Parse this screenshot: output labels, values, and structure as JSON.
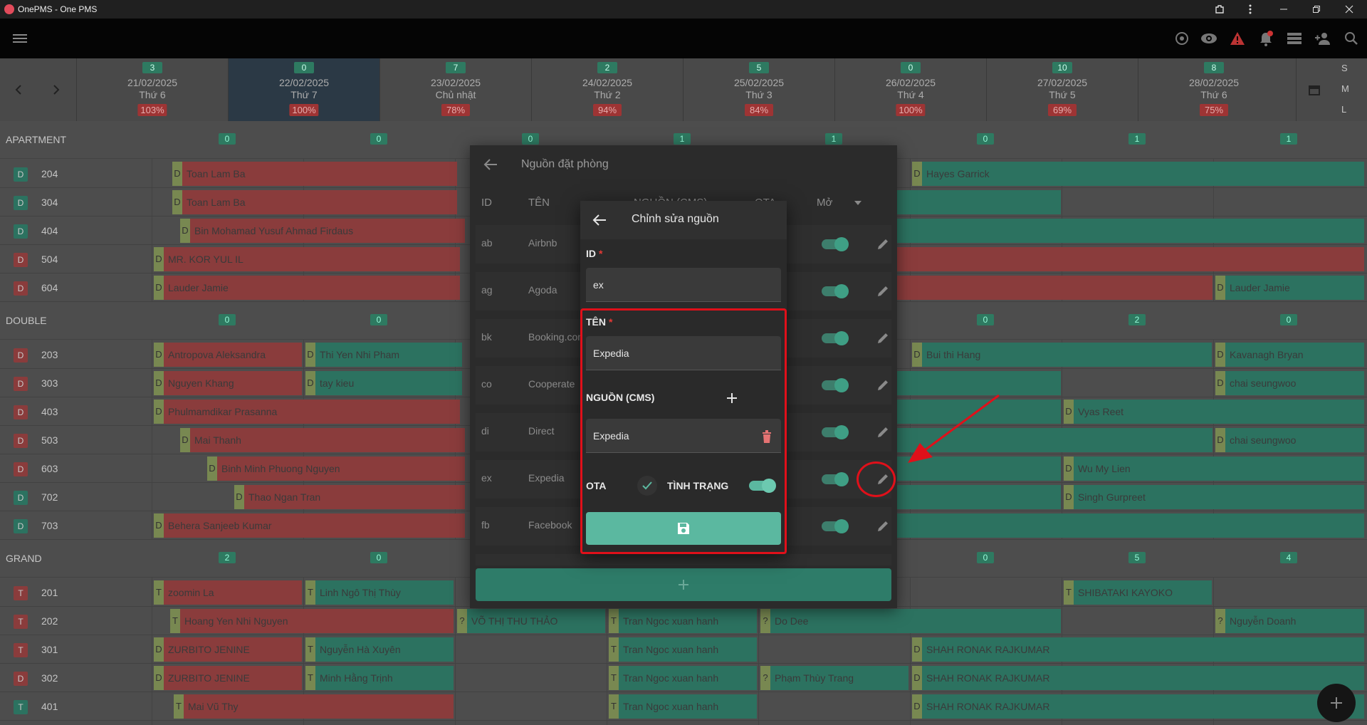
{
  "window": {
    "title": "OnePMS - One PMS"
  },
  "appbar": {
    "icons": [
      "menu-icon",
      "globe-icon",
      "eye-icon",
      "warning-icon",
      "bell-icon",
      "list-icon",
      "add-user-icon",
      "search-icon"
    ]
  },
  "dates": [
    {
      "count": "3",
      "date": "21/02/2025",
      "weekday": "Thứ 6",
      "occ": "103%"
    },
    {
      "count": "0",
      "date": "22/02/2025",
      "weekday": "Thứ 7",
      "occ": "100%"
    },
    {
      "count": "7",
      "date": "23/02/2025",
      "weekday": "Chủ nhật",
      "occ": "78%"
    },
    {
      "count": "2",
      "date": "24/02/2025",
      "weekday": "Thứ 2",
      "occ": "94%"
    },
    {
      "count": "5",
      "date": "25/02/2025",
      "weekday": "Thứ 3",
      "occ": "84%"
    },
    {
      "count": "0",
      "date": "26/02/2025",
      "weekday": "Thứ 4",
      "occ": "100%"
    },
    {
      "count": "10",
      "date": "27/02/2025",
      "weekday": "Thứ 5",
      "occ": "69%"
    },
    {
      "count": "8",
      "date": "28/02/2025",
      "weekday": "Thứ 6",
      "occ": "75%"
    }
  ],
  "size_toggle": [
    "S",
    "M",
    "L"
  ],
  "groups": {
    "apartment": {
      "name": "APARTMENT",
      "counts": [
        "0",
        "0",
        "0",
        "1",
        "1",
        "0",
        "1",
        "1"
      ]
    },
    "double": {
      "name": "DOUBLE",
      "counts": [
        "0",
        "0",
        "",
        "",
        "",
        "0",
        "2",
        "0"
      ]
    },
    "grand": {
      "name": "GRAND",
      "counts": [
        "2",
        "0",
        "",
        "",
        "",
        "0",
        "5",
        "4"
      ]
    }
  },
  "rooms": [
    {
      "type": "D",
      "no": "204"
    },
    {
      "type": "D",
      "no": "304"
    },
    {
      "type": "D",
      "no": "404"
    },
    {
      "type": "D",
      "no": "504"
    },
    {
      "type": "D",
      "no": "604"
    },
    {
      "type": "D",
      "no": "203"
    },
    {
      "type": "D",
      "no": "303"
    },
    {
      "type": "D",
      "no": "403"
    },
    {
      "type": "D",
      "no": "503"
    },
    {
      "type": "D",
      "no": "603"
    },
    {
      "type": "D",
      "no": "702"
    },
    {
      "type": "D",
      "no": "703"
    },
    {
      "type": "T",
      "no": "201"
    },
    {
      "type": "T",
      "no": "202"
    },
    {
      "type": "T",
      "no": "301"
    },
    {
      "type": "D",
      "no": "302"
    },
    {
      "type": "T",
      "no": "401"
    }
  ],
  "bookings": {
    "b1": {
      "tag": "D",
      "name": "Toan Lam Ba"
    },
    "b2": {
      "tag": "D",
      "name": "Hayes Garrick"
    },
    "b3": {
      "tag": "D",
      "name": "Toan Lam Ba"
    },
    "b4": {
      "tag": "D",
      "name": "Bin Mohamad Yusuf Ahmad Firdaus"
    },
    "b5": {
      "tag": "D",
      "name": "MR. KOR YUL IL"
    },
    "b6": {
      "tag": "D",
      "name": "Lauder Jamie"
    },
    "b7": {
      "tag": "D",
      "name": "Lauder Jamie"
    },
    "b8": {
      "tag": "D",
      "name": "Antropova Aleksandra"
    },
    "b9": {
      "tag": "D",
      "name": "Thi Yen Nhi Pham"
    },
    "b10": {
      "tag": "D",
      "name": "Bui thi Hang"
    },
    "b11": {
      "tag": "D",
      "name": "Kavanagh Bryan"
    },
    "b12": {
      "tag": "D",
      "name": "Nguyen Khang"
    },
    "b13": {
      "tag": "D",
      "name": "tay kieu"
    },
    "b14": {
      "tag": "D",
      "name": "chai seungwoo"
    },
    "b15": {
      "tag": "D",
      "name": "Phulmamdikar Prasanna"
    },
    "b16": {
      "tag": "D",
      "name": "Vyas Reet"
    },
    "b17": {
      "tag": "D",
      "name": "Mai Thanh"
    },
    "b18": {
      "tag": "D",
      "name": "chai seungwoo"
    },
    "b19": {
      "tag": "D",
      "name": "Binh Minh Phuong Nguyen"
    },
    "b20": {
      "tag": "D",
      "name": "Wu My Lien"
    },
    "b21": {
      "tag": "D",
      "name": "Thao Ngan Tran"
    },
    "b22": {
      "tag": "D",
      "name": "Singh Gurpreet"
    },
    "b23": {
      "tag": "D",
      "name": "Behera Sanjeeb Kumar"
    },
    "b24": {
      "tag": "T",
      "name": "zoomin La"
    },
    "b25": {
      "tag": "T",
      "name": "Linh Ngô Thị Thùy"
    },
    "b26": {
      "tag": "T",
      "name": "SHIBATAKI KAYOKO"
    },
    "b27": {
      "tag": "T",
      "name": "Hoang Yen Nhi Nguyen"
    },
    "b28": {
      "tag": "?",
      "name": "VÕ THỊ THU THẢO"
    },
    "b29": {
      "tag": "T",
      "name": "Tran Ngoc xuan hanh"
    },
    "b30": {
      "tag": "?",
      "name": "Do Dee"
    },
    "b31": {
      "tag": "?",
      "name": "Nguyễn Doanh"
    },
    "b32": {
      "tag": "D",
      "name": "ZURBITO JENINE"
    },
    "b33": {
      "tag": "T",
      "name": "Nguyễn Hà Xuyên"
    },
    "b34": {
      "tag": "T",
      "name": "Tran Ngoc xuan hanh"
    },
    "b35": {
      "tag": "D",
      "name": "SHAH RONAK RAJKUMAR"
    },
    "b36": {
      "tag": "D",
      "name": "ZURBITO JENINE"
    },
    "b37": {
      "tag": "T",
      "name": "Minh Hằng Trịnh"
    },
    "b38": {
      "tag": "T",
      "name": "Tran Ngoc xuan hanh"
    },
    "b39": {
      "tag": "?",
      "name": "Phạm Thùy Trang"
    },
    "b40": {
      "tag": "D",
      "name": "SHAH RONAK RAJKUMAR"
    },
    "b41": {
      "tag": "T",
      "name": "Mai Vũ Thy"
    },
    "b42": {
      "tag": "T",
      "name": "Tran Ngoc xuan hanh"
    },
    "b43": {
      "tag": "D",
      "name": "SHAH RONAK RAJKUMAR"
    }
  },
  "sources_panel": {
    "title": "Nguồn đặt phòng",
    "columns": {
      "id": "ID",
      "name": "TÊN",
      "cms": "NGUỒN (CMS)",
      "ota": "OTA",
      "open": "Mở"
    },
    "rows": [
      {
        "id": "ab",
        "name": "Airbnb",
        "enabled": true
      },
      {
        "id": "ag",
        "name": "Agoda",
        "enabled": true
      },
      {
        "id": "bk",
        "name": "Booking.com",
        "enabled": true
      },
      {
        "id": "co",
        "name": "Cooperate",
        "enabled": true
      },
      {
        "id": "di",
        "name": "Direct",
        "enabled": true
      },
      {
        "id": "ex",
        "name": "Expedia",
        "enabled": true
      },
      {
        "id": "fb",
        "name": "Facebook",
        "enabled": true
      }
    ],
    "add_icon": "plus-icon"
  },
  "edit_dialog": {
    "title": "Chỉnh sửa nguồn",
    "id_label": "ID",
    "id_value": "ex",
    "name_label": "TÊN",
    "name_value": "Expedia",
    "cms_label": "NGUỒN (CMS)",
    "cms_value": "Expedia",
    "ota_label": "OTA",
    "ota_checked": true,
    "status_label": "TÌNH TRẠNG",
    "status_on": true,
    "required_mark": "*",
    "save_icon": "save-icon"
  },
  "colors": {
    "accent": "#5bb8a0",
    "highlight": "#e0101a",
    "booking_red": "#8c3d3d",
    "booking_green": "#2d7462"
  }
}
